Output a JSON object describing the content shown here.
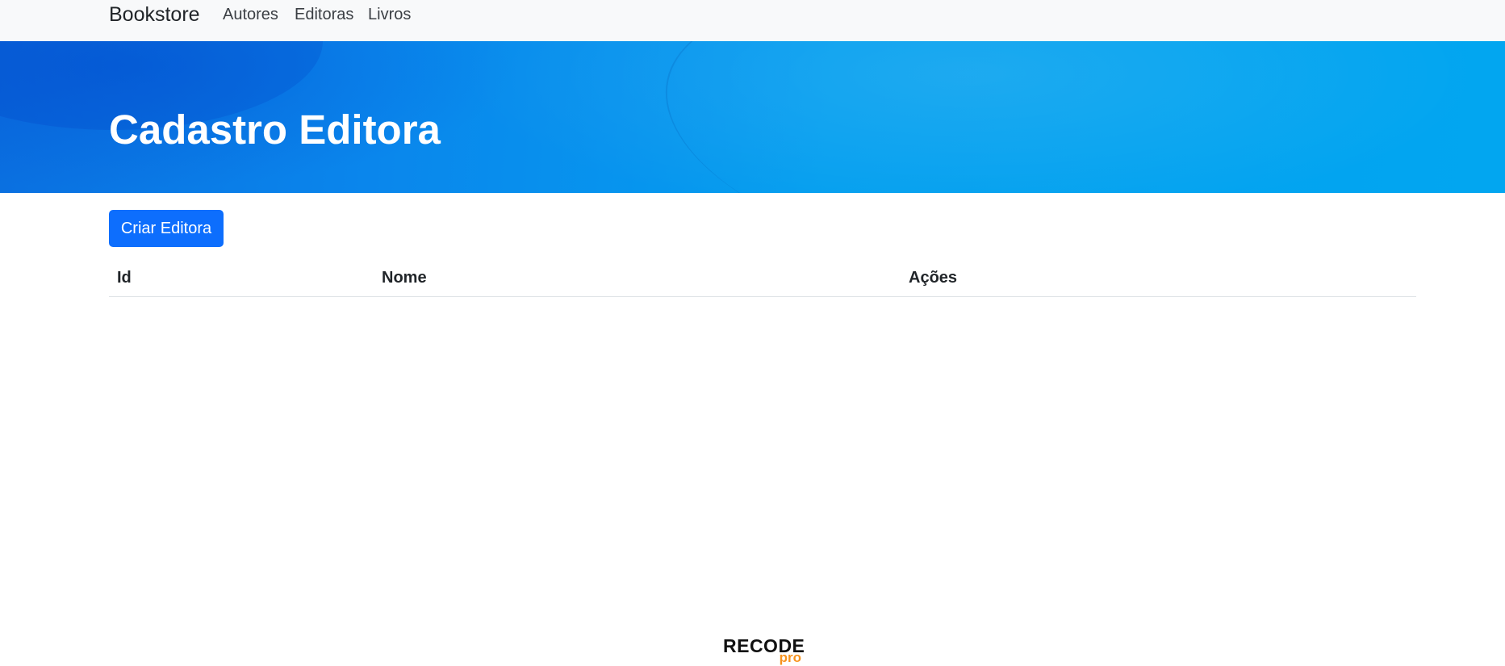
{
  "navbar": {
    "brand": "Bookstore",
    "links": [
      "Autores",
      "Editoras",
      "Livros"
    ]
  },
  "hero": {
    "title": "Cadastro Editora"
  },
  "actions": {
    "create_label": "Criar Editora"
  },
  "table": {
    "columns": [
      "Id",
      "Nome",
      "Ações"
    ],
    "rows": []
  },
  "footer": {
    "logo_main": "RECODE",
    "logo_sub": "pro"
  },
  "colors": {
    "navbar_bg": "#f8f9fa",
    "hero_blue": "#0a86ec",
    "primary": "#0d6efd",
    "logo_accent": "#f7931e"
  }
}
